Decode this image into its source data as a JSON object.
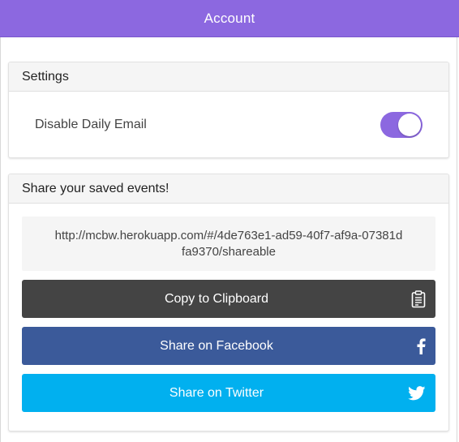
{
  "header": {
    "title": "Account"
  },
  "settings": {
    "title": "Settings",
    "daily_email_label": "Disable Daily Email",
    "daily_email_toggle_on": true
  },
  "share": {
    "title": "Share your saved events!",
    "url": "http://mcbw.herokuapp.com/#/4de763e1-ad59-40f7-af9a-07381dfa9370/shareable",
    "copy_label": "Copy to Clipboard",
    "facebook_label": "Share on Facebook",
    "twitter_label": "Share on Twitter",
    "copy_icon": "clipboard-icon",
    "facebook_icon": "facebook-icon",
    "twitter_icon": "twitter-icon"
  },
  "colors": {
    "accent": "#8c68e0",
    "copy_button": "#444444",
    "facebook_button": "#3b5a9a",
    "twitter_button": "#01b0ef"
  }
}
